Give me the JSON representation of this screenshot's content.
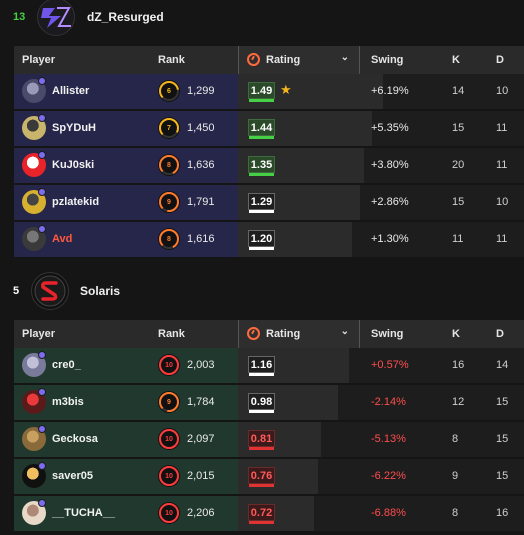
{
  "teams": [
    {
      "rank": "13",
      "rank_color": "#45d045",
      "name": "dZ_Resurged",
      "headers": {
        "player": "Player",
        "rank": "Rank",
        "rating": "Rating",
        "swing": "Swing",
        "k": "K",
        "d": "D"
      },
      "players": [
        {
          "name": "Allister",
          "level": "6",
          "level_color": "#f5b51c",
          "elo": "1,299",
          "rating": "1.49",
          "rating_style": "green",
          "star": "★",
          "swing": "+6.19%",
          "k": "14",
          "d": "10"
        },
        {
          "name": "SpYDuH",
          "level": "7",
          "level_color": "#f5b51c",
          "elo": "1,450",
          "rating": "1.44",
          "rating_style": "green",
          "star": "",
          "swing": "+5.35%",
          "k": "15",
          "d": "11"
        },
        {
          "name": "KuJ0ski",
          "level": "8",
          "level_color": "#ff7a2d",
          "elo": "1,636",
          "rating": "1.35",
          "rating_style": "green",
          "star": "",
          "swing": "+3.80%",
          "k": "20",
          "d": "11"
        },
        {
          "name": "pzlatekid",
          "level": "9",
          "level_color": "#ff7a2d",
          "elo": "1,791",
          "rating": "1.29",
          "rating_style": "white",
          "star": "",
          "swing": "+2.86%",
          "k": "15",
          "d": "10"
        },
        {
          "name": "Avd",
          "level": "8",
          "level_color": "#ff7a2d",
          "elo": "1,616",
          "rating": "1.20",
          "rating_style": "white",
          "star": "",
          "swing": "+1.30%",
          "k": "11",
          "d": "11"
        }
      ]
    },
    {
      "rank": "5",
      "rank_color": "#ffffff",
      "name": "Solaris",
      "headers": {
        "player": "Player",
        "rank": "Rank",
        "rating": "Rating",
        "swing": "Swing",
        "k": "K",
        "d": "D"
      },
      "players": [
        {
          "name": "cre0_",
          "level": "10",
          "level_color": "#ff3a3a",
          "elo": "2,003",
          "rating": "1.16",
          "rating_style": "white",
          "star": "",
          "swing": "+0.57%",
          "k": "16",
          "d": "14"
        },
        {
          "name": "m3bis",
          "level": "9",
          "level_color": "#ff7a2d",
          "elo": "1,784",
          "rating": "0.98",
          "rating_style": "white",
          "star": "",
          "swing": "-2.14%",
          "k": "12",
          "d": "15"
        },
        {
          "name": "Geckosa",
          "level": "10",
          "level_color": "#ff3a3a",
          "elo": "2,097",
          "rating": "0.81",
          "rating_style": "red",
          "star": "",
          "swing": "-5.13%",
          "k": "8",
          "d": "15"
        },
        {
          "name": "saver05",
          "level": "10",
          "level_color": "#ff3a3a",
          "elo": "2,015",
          "rating": "0.76",
          "rating_style": "red",
          "star": "",
          "swing": "-6.22%",
          "k": "9",
          "d": "15"
        },
        {
          "name": "__TUCHA__",
          "level": "10",
          "level_color": "#ff3a3a",
          "elo": "2,206",
          "rating": "0.72",
          "rating_style": "red",
          "star": "",
          "swing": "-6.88%",
          "k": "8",
          "d": "16"
        }
      ]
    }
  ]
}
